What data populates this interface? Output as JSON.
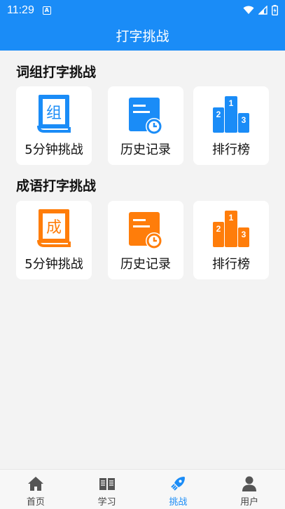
{
  "status": {
    "time": "11:29",
    "notif": "A"
  },
  "app_bar": {
    "title": "打字挑战"
  },
  "colors": {
    "primary": "#1a8cf7",
    "orange": "#ff7d0a"
  },
  "sections": [
    {
      "title": "词组打字挑战",
      "book_char": "组",
      "cards": [
        {
          "label": "5分钟挑战",
          "icon": "book-icon"
        },
        {
          "label": "历史记录",
          "icon": "history-icon"
        },
        {
          "label": "排行榜",
          "icon": "podium-icon"
        }
      ]
    },
    {
      "title": "成语打字挑战",
      "book_char": "成",
      "cards": [
        {
          "label": "5分钟挑战",
          "icon": "book-icon"
        },
        {
          "label": "历史记录",
          "icon": "history-icon"
        },
        {
          "label": "排行榜",
          "icon": "podium-icon"
        }
      ]
    }
  ],
  "podium": {
    "first": "1",
    "second": "2",
    "third": "3"
  },
  "tabs": [
    {
      "label": "首页",
      "icon": "home-icon"
    },
    {
      "label": "学习",
      "icon": "book-open-icon"
    },
    {
      "label": "挑战",
      "icon": "rocket-icon",
      "active": true
    },
    {
      "label": "用户",
      "icon": "user-icon"
    }
  ]
}
